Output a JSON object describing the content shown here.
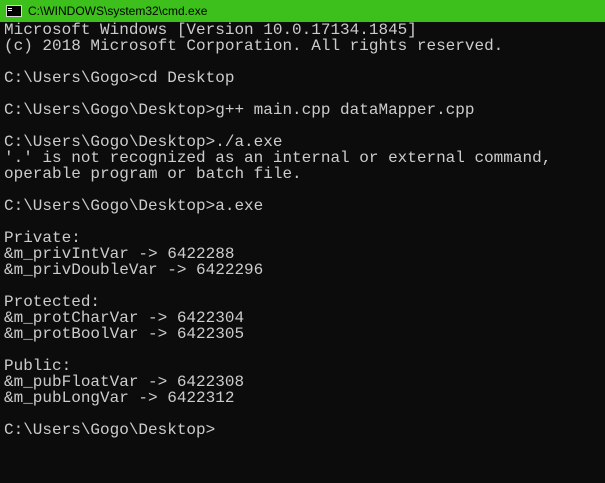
{
  "window": {
    "title": "C:\\WINDOWS\\system32\\cmd.exe",
    "titlebar_color": "#3dbf1c",
    "background_color": "#0c0c0c",
    "text_color": "#cccccc"
  },
  "console": {
    "lines": [
      "Microsoft Windows [Version 10.0.17134.1845]",
      "(c) 2018 Microsoft Corporation. All rights reserved.",
      "",
      "C:\\Users\\Gogo>cd Desktop",
      "",
      "C:\\Users\\Gogo\\Desktop>g++ main.cpp dataMapper.cpp",
      "",
      "C:\\Users\\Gogo\\Desktop>./a.exe",
      "'.' is not recognized as an internal or external command,",
      "operable program or batch file.",
      "",
      "C:\\Users\\Gogo\\Desktop>a.exe",
      "",
      "Private:",
      "&m_privIntVar -> 6422288",
      "&m_privDoubleVar -> 6422296",
      "",
      "Protected:",
      "&m_protCharVar -> 6422304",
      "&m_protBoolVar -> 6422305",
      "",
      "Public:",
      "&m_pubFloatVar -> 6422308",
      "&m_pubLongVar -> 6422312",
      "",
      "C:\\Users\\Gogo\\Desktop>"
    ]
  }
}
